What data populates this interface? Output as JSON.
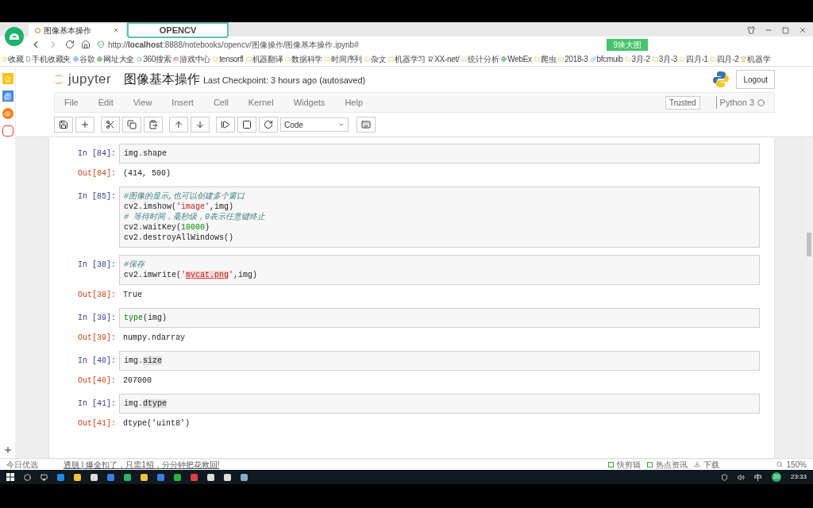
{
  "browser": {
    "tabs": [
      {
        "title": "图像基本操作",
        "selected": true
      }
    ],
    "overlay_tab": "OPENCV",
    "address": "http://**localhost**:8888/notebooks/opencv/图像操作/图像基本操作.ipynb#",
    "address_badge": "9块大图",
    "bookmarks": [
      {
        "label": "收藏",
        "kind": "star"
      },
      {
        "label": "手机收藏夹",
        "kind": "phone"
      },
      {
        "label": "谷歌",
        "kind": "google"
      },
      {
        "label": "网址大全",
        "kind": "globe"
      },
      {
        "label": "360搜索",
        "kind": "search"
      },
      {
        "label": "游戏中心",
        "kind": "game"
      },
      {
        "label": "tensorfl",
        "kind": "folder"
      },
      {
        "label": "机器翻译",
        "kind": "folder"
      },
      {
        "label": "数据科学",
        "kind": "folder"
      },
      {
        "label": "时间序列",
        "kind": "folder"
      },
      {
        "label": "杂文",
        "kind": "folder"
      },
      {
        "label": "机器学习",
        "kind": "folder"
      },
      {
        "label": "XX-net/",
        "kind": "github"
      },
      {
        "label": "统计分析",
        "kind": "folder"
      },
      {
        "label": "WebEx",
        "kind": "globe"
      },
      {
        "label": "爬虫",
        "kind": "folder"
      },
      {
        "label": "2018-3",
        "kind": "folder"
      },
      {
        "label": "bfcmuib",
        "kind": "link"
      },
      {
        "label": "3月-2",
        "kind": "folder"
      },
      {
        "label": "3月-3",
        "kind": "folder"
      },
      {
        "label": "四月-1",
        "kind": "folder"
      },
      {
        "label": "四月-2",
        "kind": "folder"
      },
      {
        "label": "机器学",
        "kind": "trophy"
      }
    ]
  },
  "jupyter": {
    "logo": "jupyter",
    "notebook_title": "图像基本操作",
    "checkpoint": "Last Checkpoint: 3 hours ago (autosaved)",
    "logout": "Logout",
    "menu": [
      "File",
      "Edit",
      "View",
      "Insert",
      "Cell",
      "Kernel",
      "Widgets",
      "Help"
    ],
    "trusted": "Trusted",
    "kernel": "Python 3",
    "cell_type": "Code"
  },
  "cells": [
    {
      "prompt": "In [84]:",
      "lines": [
        [
          {
            "t": "img.shape",
            "kind": "plain"
          }
        ]
      ],
      "out_prompt": "Out[84]:",
      "output": "(414, 500)"
    },
    {
      "prompt": "In [85]:",
      "lines": [
        [
          {
            "t": "#图像的显示,也可以创建多个窗口",
            "kind": "comment"
          }
        ],
        [
          {
            "t": "cv2.imshow(",
            "kind": "plain"
          },
          {
            "t": "'image'",
            "kind": "string"
          },
          {
            "t": ",img)",
            "kind": "plain"
          }
        ],
        [
          {
            "t": "# 等待时间，毫秒级，0表示任意键终止",
            "kind": "comment"
          }
        ],
        [
          {
            "t": "cv2.waitKey(",
            "kind": "plain"
          },
          {
            "t": "10000",
            "kind": "number"
          },
          {
            "t": ")",
            "kind": "plain"
          }
        ],
        [
          {
            "t": "cv2.destroyAllWindows()",
            "kind": "plain"
          }
        ]
      ]
    },
    {
      "prompt": "In [38]:",
      "lines": [
        [
          {
            "t": "#保存",
            "kind": "comment"
          }
        ],
        [
          {
            "t": "cv2.imwrite(",
            "kind": "plain"
          },
          {
            "t": "'",
            "kind": "string"
          },
          {
            "t": "mycat.png",
            "kind": "marked"
          },
          {
            "t": "'",
            "kind": "string"
          },
          {
            "t": ",img)",
            "kind": "plain"
          }
        ]
      ],
      "out_prompt": "Out[38]:",
      "output": "True"
    },
    {
      "prompt": "In [39]:",
      "lines": [
        [
          {
            "t": "type",
            "kind": "builtin"
          },
          {
            "t": "(img)",
            "kind": "plain"
          }
        ]
      ],
      "out_prompt": "Out[39]:",
      "output": "numpy.ndarray"
    },
    {
      "prompt": "In [40]:",
      "lines": [
        [
          {
            "t": "img.",
            "kind": "plain"
          },
          {
            "t": "size",
            "kind": "highlight"
          }
        ]
      ],
      "out_prompt": "Out[40]:",
      "output": "207000"
    },
    {
      "prompt": "In [41]:",
      "lines": [
        [
          {
            "t": "img.",
            "kind": "plain"
          },
          {
            "t": "dtype",
            "kind": "highlight"
          }
        ]
      ],
      "out_prompt": "Out[41]:",
      "output": "dtype('uint8')"
    }
  ],
  "status_bar": {
    "left": "今日优选",
    "news": "透脱 | 爆全扣了，只需1招，分分钟把花救回!",
    "right": [
      "快剪辑",
      "热点资讯",
      "下载"
    ],
    "zoom": "150%"
  },
  "taskbar": {
    "ime": "中",
    "badge": "20",
    "time": "23:33"
  }
}
